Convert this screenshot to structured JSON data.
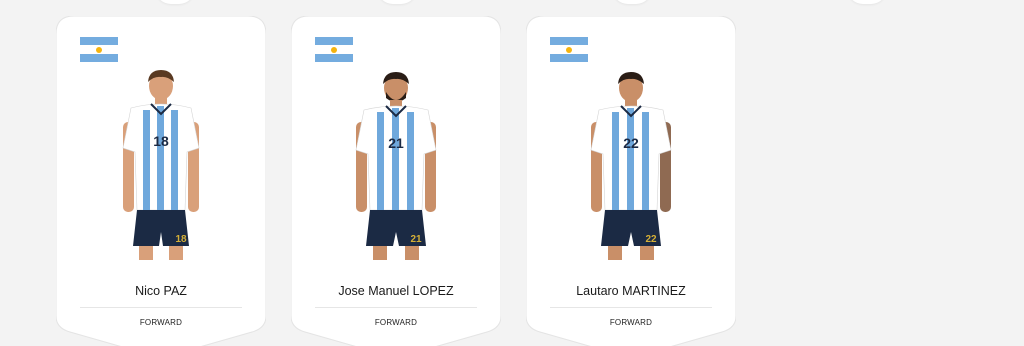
{
  "colors": {
    "card_bg": "#ffffff",
    "page_bg": "#f3f3f3",
    "flag_blue": "#74acdf",
    "flag_white": "#ffffff",
    "flag_sun": "#f6b40e",
    "jersey_stripe": "#6fa8dc",
    "shorts": "#1b2a44"
  },
  "players": [
    {
      "name": "Nico PAZ",
      "position": "FORWARD",
      "number": "18",
      "flag_icon": "argentina-flag-icon"
    },
    {
      "name": "Jose Manuel LOPEZ",
      "position": "FORWARD",
      "number": "21",
      "flag_icon": "argentina-flag-icon"
    },
    {
      "name": "Lautaro MARTINEZ",
      "position": "FORWARD",
      "number": "22",
      "flag_icon": "argentina-flag-icon"
    }
  ]
}
